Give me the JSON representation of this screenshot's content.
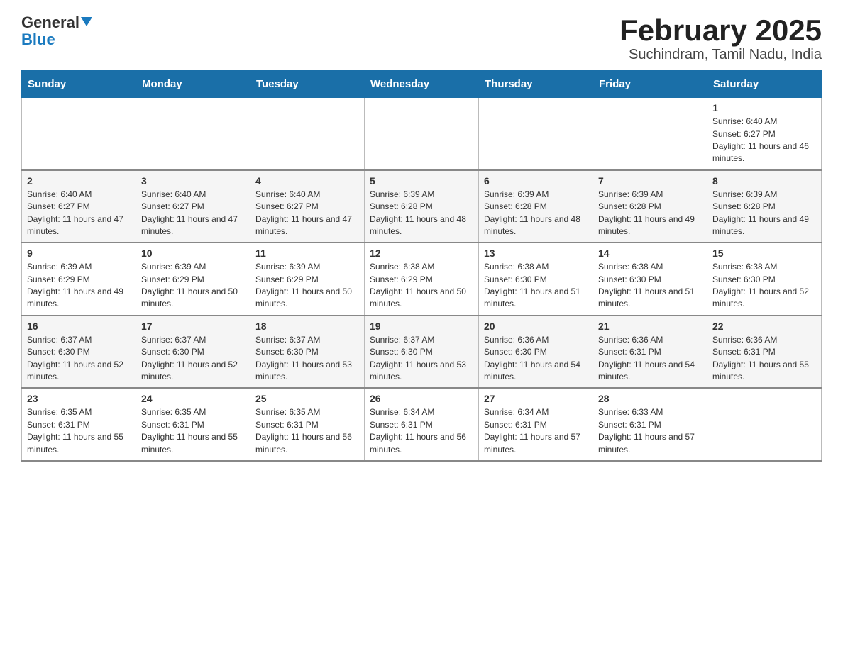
{
  "header": {
    "logo": {
      "general": "General",
      "blue": "Blue"
    },
    "title": "February 2025",
    "subtitle": "Suchindram, Tamil Nadu, India"
  },
  "weekdays": [
    "Sunday",
    "Monday",
    "Tuesday",
    "Wednesday",
    "Thursday",
    "Friday",
    "Saturday"
  ],
  "weeks": [
    [
      {
        "day": "",
        "sunrise": "",
        "sunset": "",
        "daylight": ""
      },
      {
        "day": "",
        "sunrise": "",
        "sunset": "",
        "daylight": ""
      },
      {
        "day": "",
        "sunrise": "",
        "sunset": "",
        "daylight": ""
      },
      {
        "day": "",
        "sunrise": "",
        "sunset": "",
        "daylight": ""
      },
      {
        "day": "",
        "sunrise": "",
        "sunset": "",
        "daylight": ""
      },
      {
        "day": "",
        "sunrise": "",
        "sunset": "",
        "daylight": ""
      },
      {
        "day": "1",
        "sunrise": "Sunrise: 6:40 AM",
        "sunset": "Sunset: 6:27 PM",
        "daylight": "Daylight: 11 hours and 46 minutes."
      }
    ],
    [
      {
        "day": "2",
        "sunrise": "Sunrise: 6:40 AM",
        "sunset": "Sunset: 6:27 PM",
        "daylight": "Daylight: 11 hours and 47 minutes."
      },
      {
        "day": "3",
        "sunrise": "Sunrise: 6:40 AM",
        "sunset": "Sunset: 6:27 PM",
        "daylight": "Daylight: 11 hours and 47 minutes."
      },
      {
        "day": "4",
        "sunrise": "Sunrise: 6:40 AM",
        "sunset": "Sunset: 6:27 PM",
        "daylight": "Daylight: 11 hours and 47 minutes."
      },
      {
        "day": "5",
        "sunrise": "Sunrise: 6:39 AM",
        "sunset": "Sunset: 6:28 PM",
        "daylight": "Daylight: 11 hours and 48 minutes."
      },
      {
        "day": "6",
        "sunrise": "Sunrise: 6:39 AM",
        "sunset": "Sunset: 6:28 PM",
        "daylight": "Daylight: 11 hours and 48 minutes."
      },
      {
        "day": "7",
        "sunrise": "Sunrise: 6:39 AM",
        "sunset": "Sunset: 6:28 PM",
        "daylight": "Daylight: 11 hours and 49 minutes."
      },
      {
        "day": "8",
        "sunrise": "Sunrise: 6:39 AM",
        "sunset": "Sunset: 6:28 PM",
        "daylight": "Daylight: 11 hours and 49 minutes."
      }
    ],
    [
      {
        "day": "9",
        "sunrise": "Sunrise: 6:39 AM",
        "sunset": "Sunset: 6:29 PM",
        "daylight": "Daylight: 11 hours and 49 minutes."
      },
      {
        "day": "10",
        "sunrise": "Sunrise: 6:39 AM",
        "sunset": "Sunset: 6:29 PM",
        "daylight": "Daylight: 11 hours and 50 minutes."
      },
      {
        "day": "11",
        "sunrise": "Sunrise: 6:39 AM",
        "sunset": "Sunset: 6:29 PM",
        "daylight": "Daylight: 11 hours and 50 minutes."
      },
      {
        "day": "12",
        "sunrise": "Sunrise: 6:38 AM",
        "sunset": "Sunset: 6:29 PM",
        "daylight": "Daylight: 11 hours and 50 minutes."
      },
      {
        "day": "13",
        "sunrise": "Sunrise: 6:38 AM",
        "sunset": "Sunset: 6:30 PM",
        "daylight": "Daylight: 11 hours and 51 minutes."
      },
      {
        "day": "14",
        "sunrise": "Sunrise: 6:38 AM",
        "sunset": "Sunset: 6:30 PM",
        "daylight": "Daylight: 11 hours and 51 minutes."
      },
      {
        "day": "15",
        "sunrise": "Sunrise: 6:38 AM",
        "sunset": "Sunset: 6:30 PM",
        "daylight": "Daylight: 11 hours and 52 minutes."
      }
    ],
    [
      {
        "day": "16",
        "sunrise": "Sunrise: 6:37 AM",
        "sunset": "Sunset: 6:30 PM",
        "daylight": "Daylight: 11 hours and 52 minutes."
      },
      {
        "day": "17",
        "sunrise": "Sunrise: 6:37 AM",
        "sunset": "Sunset: 6:30 PM",
        "daylight": "Daylight: 11 hours and 52 minutes."
      },
      {
        "day": "18",
        "sunrise": "Sunrise: 6:37 AM",
        "sunset": "Sunset: 6:30 PM",
        "daylight": "Daylight: 11 hours and 53 minutes."
      },
      {
        "day": "19",
        "sunrise": "Sunrise: 6:37 AM",
        "sunset": "Sunset: 6:30 PM",
        "daylight": "Daylight: 11 hours and 53 minutes."
      },
      {
        "day": "20",
        "sunrise": "Sunrise: 6:36 AM",
        "sunset": "Sunset: 6:30 PM",
        "daylight": "Daylight: 11 hours and 54 minutes."
      },
      {
        "day": "21",
        "sunrise": "Sunrise: 6:36 AM",
        "sunset": "Sunset: 6:31 PM",
        "daylight": "Daylight: 11 hours and 54 minutes."
      },
      {
        "day": "22",
        "sunrise": "Sunrise: 6:36 AM",
        "sunset": "Sunset: 6:31 PM",
        "daylight": "Daylight: 11 hours and 55 minutes."
      }
    ],
    [
      {
        "day": "23",
        "sunrise": "Sunrise: 6:35 AM",
        "sunset": "Sunset: 6:31 PM",
        "daylight": "Daylight: 11 hours and 55 minutes."
      },
      {
        "day": "24",
        "sunrise": "Sunrise: 6:35 AM",
        "sunset": "Sunset: 6:31 PM",
        "daylight": "Daylight: 11 hours and 55 minutes."
      },
      {
        "day": "25",
        "sunrise": "Sunrise: 6:35 AM",
        "sunset": "Sunset: 6:31 PM",
        "daylight": "Daylight: 11 hours and 56 minutes."
      },
      {
        "day": "26",
        "sunrise": "Sunrise: 6:34 AM",
        "sunset": "Sunset: 6:31 PM",
        "daylight": "Daylight: 11 hours and 56 minutes."
      },
      {
        "day": "27",
        "sunrise": "Sunrise: 6:34 AM",
        "sunset": "Sunset: 6:31 PM",
        "daylight": "Daylight: 11 hours and 57 minutes."
      },
      {
        "day": "28",
        "sunrise": "Sunrise: 6:33 AM",
        "sunset": "Sunset: 6:31 PM",
        "daylight": "Daylight: 11 hours and 57 minutes."
      },
      {
        "day": "",
        "sunrise": "",
        "sunset": "",
        "daylight": ""
      }
    ]
  ]
}
